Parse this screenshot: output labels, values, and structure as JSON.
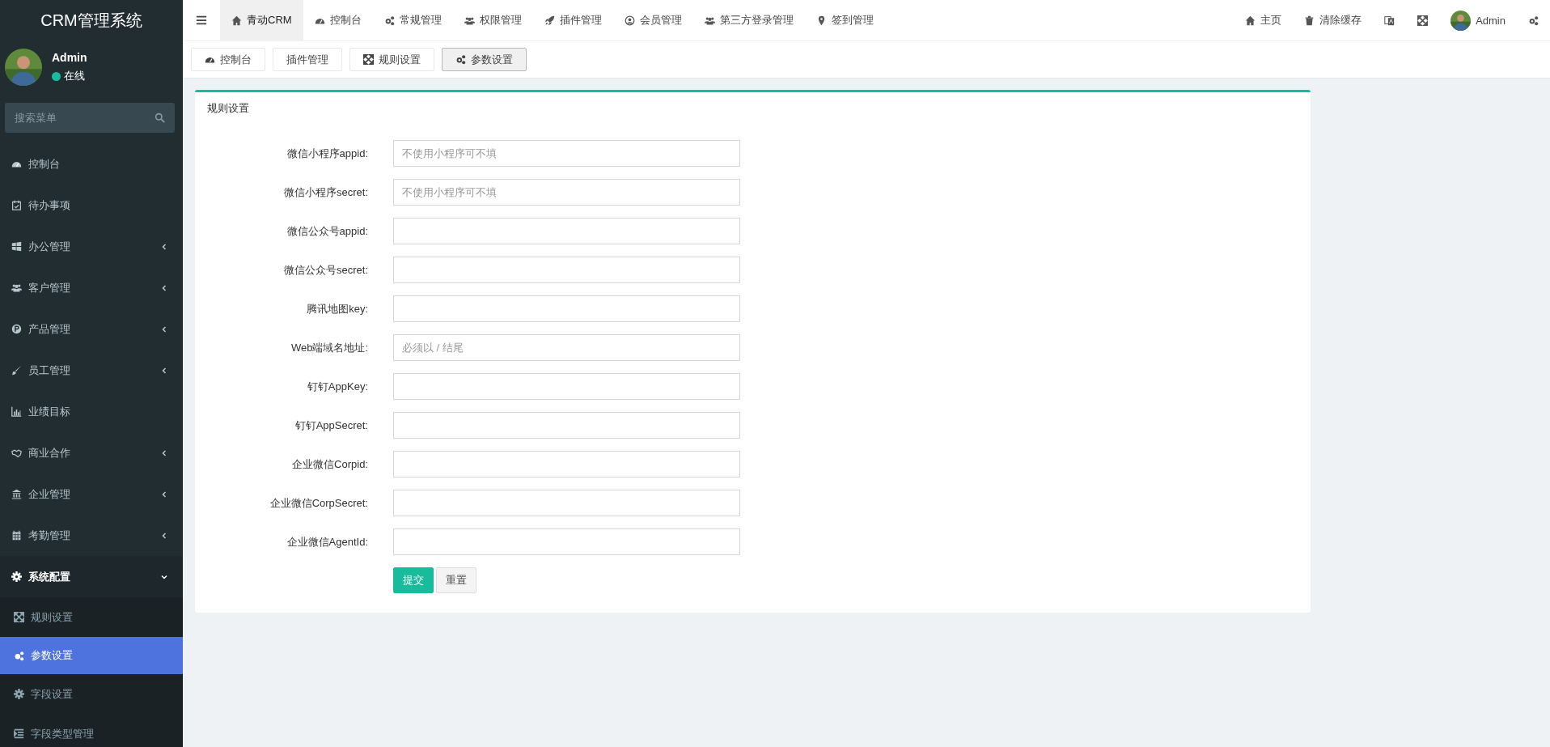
{
  "sidebar": {
    "title": "CRM管理系统",
    "user": {
      "name": "Admin",
      "status": "在线"
    },
    "search": {
      "placeholder": "搜索菜单"
    },
    "items": [
      {
        "kind": "link",
        "label": "控制台"
      },
      {
        "kind": "link",
        "label": "待办事项"
      },
      {
        "kind": "group",
        "label": "办公管理",
        "expanded": false
      },
      {
        "kind": "group",
        "label": "客户管理",
        "expanded": false
      },
      {
        "kind": "group",
        "label": "产品管理",
        "expanded": false
      },
      {
        "kind": "group",
        "label": "员工管理",
        "expanded": false
      },
      {
        "kind": "link",
        "label": "业绩目标"
      },
      {
        "kind": "group",
        "label": "商业合作",
        "expanded": false
      },
      {
        "kind": "group",
        "label": "企业管理",
        "expanded": false
      },
      {
        "kind": "group",
        "label": "考勤管理",
        "expanded": false
      },
      {
        "kind": "group",
        "label": "系统配置",
        "expanded": true,
        "children": [
          {
            "label": "规则设置",
            "selected": false
          },
          {
            "label": "参数设置",
            "selected": true
          },
          {
            "label": "字段设置",
            "selected": false
          },
          {
            "label": "字段类型管理",
            "selected": false
          }
        ]
      }
    ]
  },
  "top_nav": {
    "tabs": [
      {
        "label": "青动CRM",
        "selected": true
      },
      {
        "label": "控制台",
        "selected": false
      },
      {
        "label": "常规管理",
        "selected": false
      },
      {
        "label": "权限管理",
        "selected": false
      },
      {
        "label": "插件管理",
        "selected": false
      },
      {
        "label": "会员管理",
        "selected": false
      },
      {
        "label": "第三方登录管理",
        "selected": false
      },
      {
        "label": "签到管理",
        "selected": false
      }
    ],
    "right": {
      "home": "主页",
      "clear_cache": "清除缓存",
      "user": "Admin"
    }
  },
  "page_tabs": [
    {
      "label": "控制台",
      "selected": false
    },
    {
      "label": "插件管理",
      "selected": false
    },
    {
      "label": "规则设置",
      "selected": false
    },
    {
      "label": "参数设置",
      "selected": true
    }
  ],
  "card": {
    "title": "规则设置",
    "fields": [
      {
        "label": "微信小程序appid:",
        "placeholder": "不使用小程序可不填"
      },
      {
        "label": "微信小程序secret:",
        "placeholder": "不使用小程序可不填"
      },
      {
        "label": "微信公众号appid:"
      },
      {
        "label": "微信公众号secret:"
      },
      {
        "label": "腾讯地图key:"
      },
      {
        "label": "Web端域名地址:",
        "placeholder": "必须以 / 结尾"
      },
      {
        "label": "钉钉AppKey:"
      },
      {
        "label": "钉钉AppSecret:"
      },
      {
        "label": "企业微信Corpid:"
      },
      {
        "label": "企业微信CorpSecret:"
      },
      {
        "label": "企业微信AgentId:"
      }
    ],
    "buttons": [
      {
        "kind": "submit",
        "label": "提交"
      },
      {
        "kind": "reset",
        "label": "重置"
      }
    ]
  }
}
